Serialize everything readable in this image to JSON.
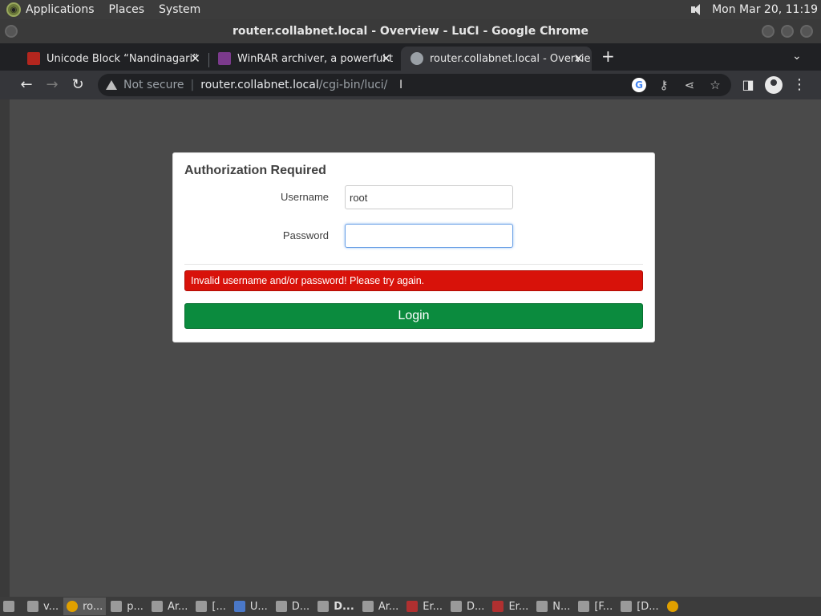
{
  "top_panel": {
    "menus": [
      "Applications",
      "Places",
      "System"
    ],
    "clock": "Mon Mar 20, 11:19"
  },
  "window": {
    "title": "router.collabnet.local - Overview - LuCI - Google Chrome"
  },
  "tabs": [
    {
      "title": "Unicode Block “Nandinagari”",
      "active": false,
      "favicon_color": "#b3261e"
    },
    {
      "title": "WinRAR archiver, a powerful t",
      "active": false,
      "favicon_color": "#7b3a8c"
    },
    {
      "title": "router.collabnet.local - Overvie",
      "active": true,
      "favicon_color": "#9aa0a6"
    }
  ],
  "tab_controls": {
    "new_tab": "+",
    "tab_search": "⌄"
  },
  "toolbar": {
    "security_label": "Not secure",
    "url_host": "router.collabnet.local",
    "url_path": "/cgi-bin/luci/"
  },
  "login": {
    "heading": "Authorization Required",
    "username_label": "Username",
    "username_value": "root",
    "password_label": "Password",
    "password_value": "",
    "error_message": "Invalid username and/or password! Please try again.",
    "login_button": "Login"
  },
  "taskbar": [
    {
      "label": "v...",
      "bold": false
    },
    {
      "label": "ro...",
      "bold": false,
      "active": true
    },
    {
      "label": "p...",
      "bold": false
    },
    {
      "label": "Ar...",
      "bold": false
    },
    {
      "label": "[...",
      "bold": false
    },
    {
      "label": "U...",
      "bold": false
    },
    {
      "label": "D...",
      "bold": false
    },
    {
      "label": "D...",
      "bold": true
    },
    {
      "label": "Ar...",
      "bold": false
    },
    {
      "label": "Er...",
      "bold": false
    },
    {
      "label": "D...",
      "bold": false
    },
    {
      "label": "Er...",
      "bold": false
    },
    {
      "label": "N...",
      "bold": false
    },
    {
      "label": "[F...",
      "bold": false
    },
    {
      "label": "[D...",
      "bold": false
    }
  ],
  "colors": {
    "alert_red": "#d8120a",
    "login_green": "#0b8b3e",
    "page_bg": "#4a4a4a"
  }
}
